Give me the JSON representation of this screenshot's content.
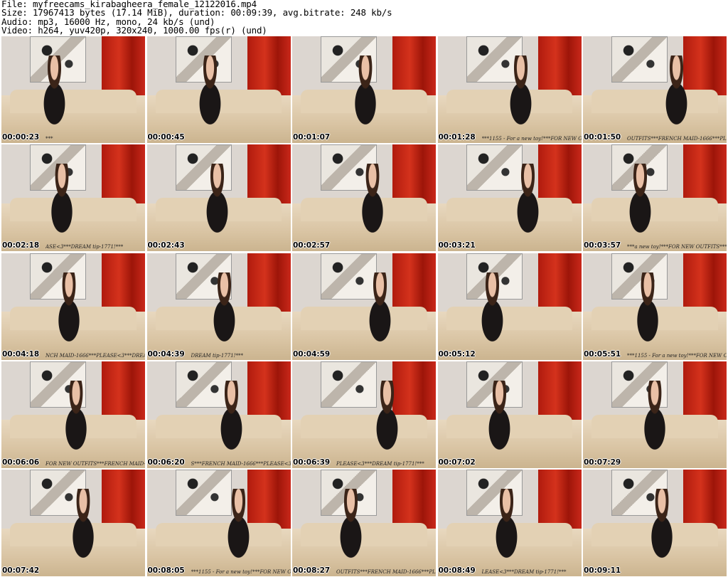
{
  "header": {
    "file_line": "File: myfreecams_kirabagheera_female_12122016.mp4",
    "size_line": "Size: 17967413 bytes (17.14 MiB), duration: 00:09:39, avg.bitrate: 248 kb/s",
    "audio_line": "Audio: mp3, 16000 Hz, mono, 24 kb/s (und)",
    "video_line": "Video: h264, yuv420p, 320x240, 1000.00 fps(r) (und)"
  },
  "thumbnails": [
    {
      "timestamp": "00:00:23",
      "ticker": "***"
    },
    {
      "timestamp": "00:00:45",
      "ticker": ""
    },
    {
      "timestamp": "00:01:07",
      "ticker": ""
    },
    {
      "timestamp": "00:01:28",
      "ticker": "***1155 - For a new toy!***FOR NEW OUTFITS"
    },
    {
      "timestamp": "00:01:50",
      "ticker": "OUTFITS***FRENCH MAID-1666***PLEASE"
    },
    {
      "timestamp": "00:02:18",
      "ticker": "ASE<3***DREAM tip-1771!***"
    },
    {
      "timestamp": "00:02:43",
      "ticker": ""
    },
    {
      "timestamp": "00:02:57",
      "ticker": ""
    },
    {
      "timestamp": "00:03:21",
      "ticker": ""
    },
    {
      "timestamp": "00:03:57",
      "ticker": "***a new toy!***FOR NEW OUTFITS***FRENCH M"
    },
    {
      "timestamp": "00:04:18",
      "ticker": "NCH MAID-1666***PLEASE<3***DREAM tip-"
    },
    {
      "timestamp": "00:04:39",
      "ticker": "DREAM tip-1771!***"
    },
    {
      "timestamp": "00:04:59",
      "ticker": ""
    },
    {
      "timestamp": "00:05:12",
      "ticker": ""
    },
    {
      "timestamp": "00:05:51",
      "ticker": "***1155 - For a new toy!***FOR NEW OUTFITS"
    },
    {
      "timestamp": "00:06:06",
      "ticker": "FOR NEW OUTFITS***FRENCH MAID-1666"
    },
    {
      "timestamp": "00:06:20",
      "ticker": "S***FRENCH MAID-1666***PLEASE<3***DR"
    },
    {
      "timestamp": "00:06:39",
      "ticker": "PLEASE<3***DREAM tip-1771!***"
    },
    {
      "timestamp": "00:07:02",
      "ticker": ""
    },
    {
      "timestamp": "00:07:29",
      "ticker": ""
    },
    {
      "timestamp": "00:07:42",
      "ticker": ""
    },
    {
      "timestamp": "00:08:05",
      "ticker": "***1155 - For a new toy!***FOR NEW OUTFITS"
    },
    {
      "timestamp": "00:08:27",
      "ticker": "OUTFITS***FRENCH MAID-1666***PLEASE<"
    },
    {
      "timestamp": "00:08:49",
      "ticker": "LEASE<3***DREAM tip-1771!***"
    },
    {
      "timestamp": "00:09:11",
      "ticker": ""
    }
  ],
  "colors": {
    "background": "#ffffff",
    "curtain": "#c9281a",
    "sofa": "#d9c4a3"
  }
}
